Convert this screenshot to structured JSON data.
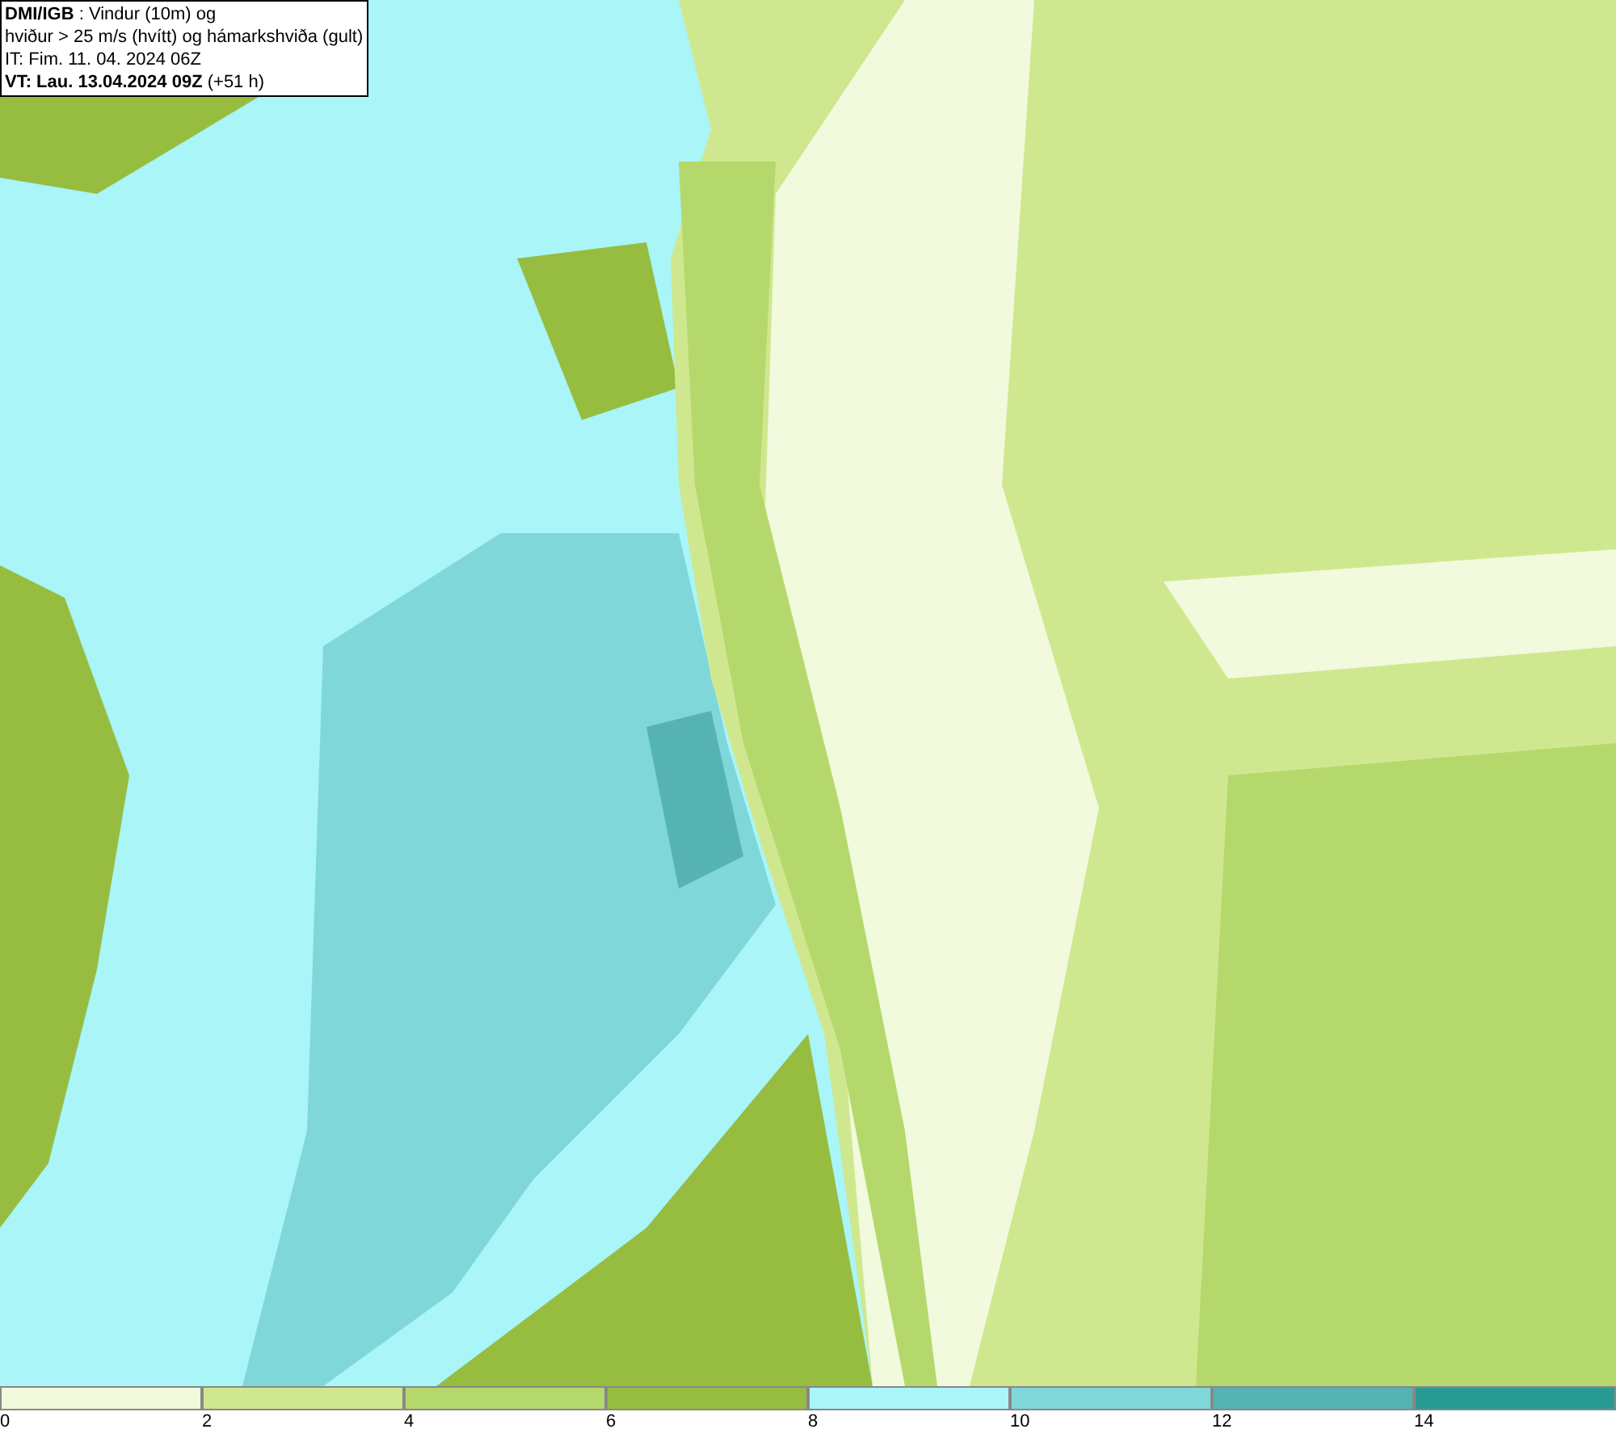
{
  "title_box": {
    "lines": [
      "**DMI/IGB** : Vindur (10m) og",
      "hviður > 25 m/s (hvítt) og hámarkshviða (gult)",
      "IT: Fim. 11. 04. 2024 06Z",
      "**VT: Lau. 13.04.2024 09Z** (+51 h)"
    ]
  },
  "legend": {
    "bins": [
      {
        "color": "#f1fadc"
      },
      {
        "color": "#cfe88f"
      },
      {
        "color": "#b5d86c"
      },
      {
        "color": "#97bd40"
      },
      {
        "color": "#a9f5f8"
      },
      {
        "color": "#80d7da"
      },
      {
        "color": "#56b3b3"
      },
      {
        "color": "#289a94"
      }
    ],
    "ticks": [
      "0",
      "2",
      "4",
      "6",
      "8",
      "10",
      "12",
      "14"
    ]
  }
}
